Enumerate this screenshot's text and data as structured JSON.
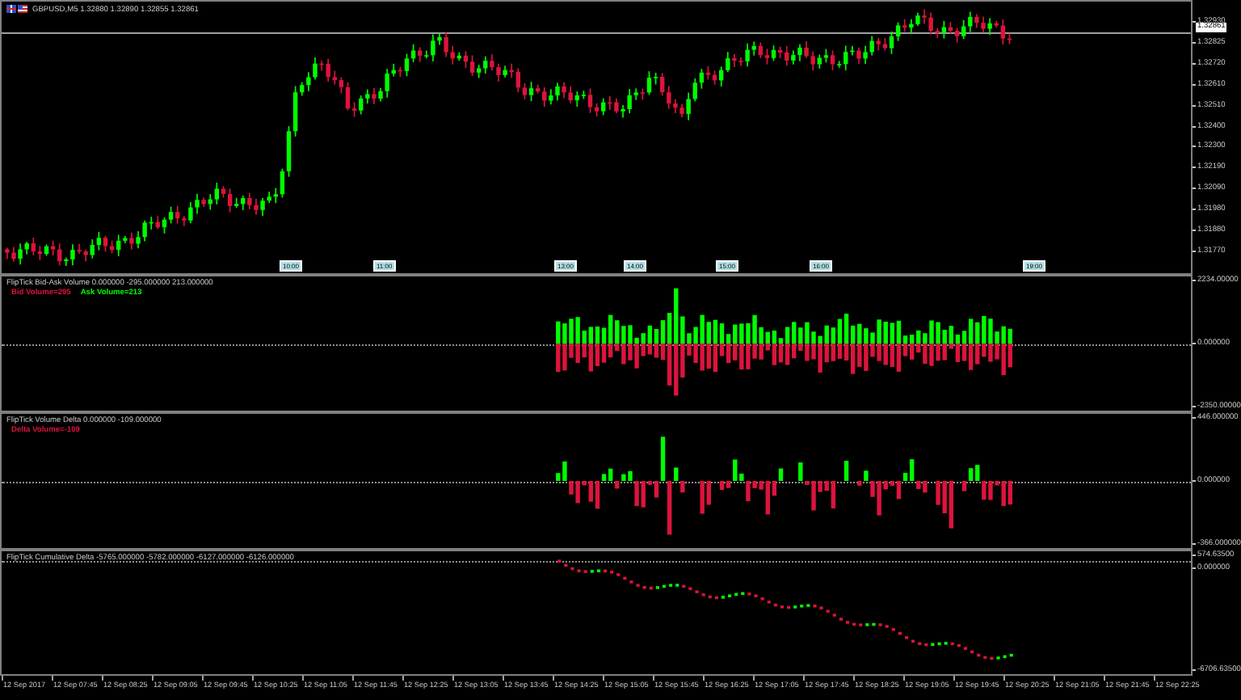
{
  "chart": {
    "symbol": "GBPUSD,M5",
    "ohlc": "1.32880 1.32890 1.32855 1.32861",
    "bid_price": "1.32861",
    "price_labels": [
      "1.32930",
      "1.32825",
      "1.32720",
      "1.32610",
      "1.32510",
      "1.32400",
      "1.32300",
      "1.32190",
      "1.32090",
      "1.31980",
      "1.31880",
      "1.31770"
    ],
    "time_markers": [
      "10:00",
      "11:00",
      "13:00",
      "14:00",
      "15:00",
      "16:00",
      "19:00"
    ]
  },
  "indicators": [
    {
      "kind": "bid_ask",
      "title": "FlipTick Bid-Ask Volume 0.000000 -295.000000 213.000000",
      "legend": [
        {
          "text": "Bid Volume=295",
          "color": "#dc143c"
        },
        {
          "text": "Ask Volume=213",
          "color": "#00ff00"
        }
      ],
      "axis_labels": [
        "2234.00000",
        "0.000000",
        "-2350.00000"
      ]
    },
    {
      "kind": "delta",
      "title": "FlipTick Volume Delta 0.000000 -109.000000",
      "legend": [
        {
          "text": "Delta Volume=-109",
          "color": "#dc143c"
        }
      ],
      "axis_labels": [
        "446.000000",
        "0.000000",
        "-366.000000"
      ]
    },
    {
      "kind": "cumulative",
      "title": "FlipTick Cumulative Delta -5765.000000 -5782.000000 -6127.000000 -6126.000000",
      "axis_labels": [
        "574.63500",
        "0.000000",
        "-6706.63500"
      ]
    }
  ],
  "time_axis": [
    "12 Sep 2017",
    "12 Sep 07:45",
    "12 Sep 08:25",
    "12 Sep 09:05",
    "12 Sep 09:45",
    "12 Sep 10:25",
    "12 Sep 11:05",
    "12 Sep 11:45",
    "12 Sep 12:25",
    "12 Sep 13:05",
    "12 Sep 13:45",
    "12 Sep 14:25",
    "12 Sep 15:05",
    "12 Sep 15:45",
    "12 Sep 16:25",
    "12 Sep 17:05",
    "12 Sep 17:45",
    "12 Sep 18:25",
    "12 Sep 19:05",
    "12 Sep 19:45",
    "12 Sep 20:25",
    "12 Sep 21:05",
    "12 Sep 21:45",
    "12 Sep 22:25"
  ]
}
